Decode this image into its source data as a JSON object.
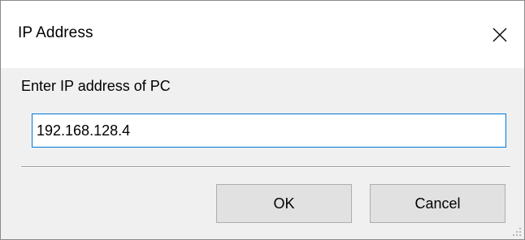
{
  "dialog": {
    "title": "IP Address",
    "prompt": "Enter IP address of PC",
    "input_value": "192.168.128.4",
    "ok_label": "OK",
    "cancel_label": "Cancel"
  },
  "icons": {
    "close": "close-icon",
    "resize": "resize-grip-icon"
  },
  "colors": {
    "focus_border": "#0078d7",
    "dialog_background": "#f0f0f0",
    "button_background": "#e1e1e1"
  }
}
